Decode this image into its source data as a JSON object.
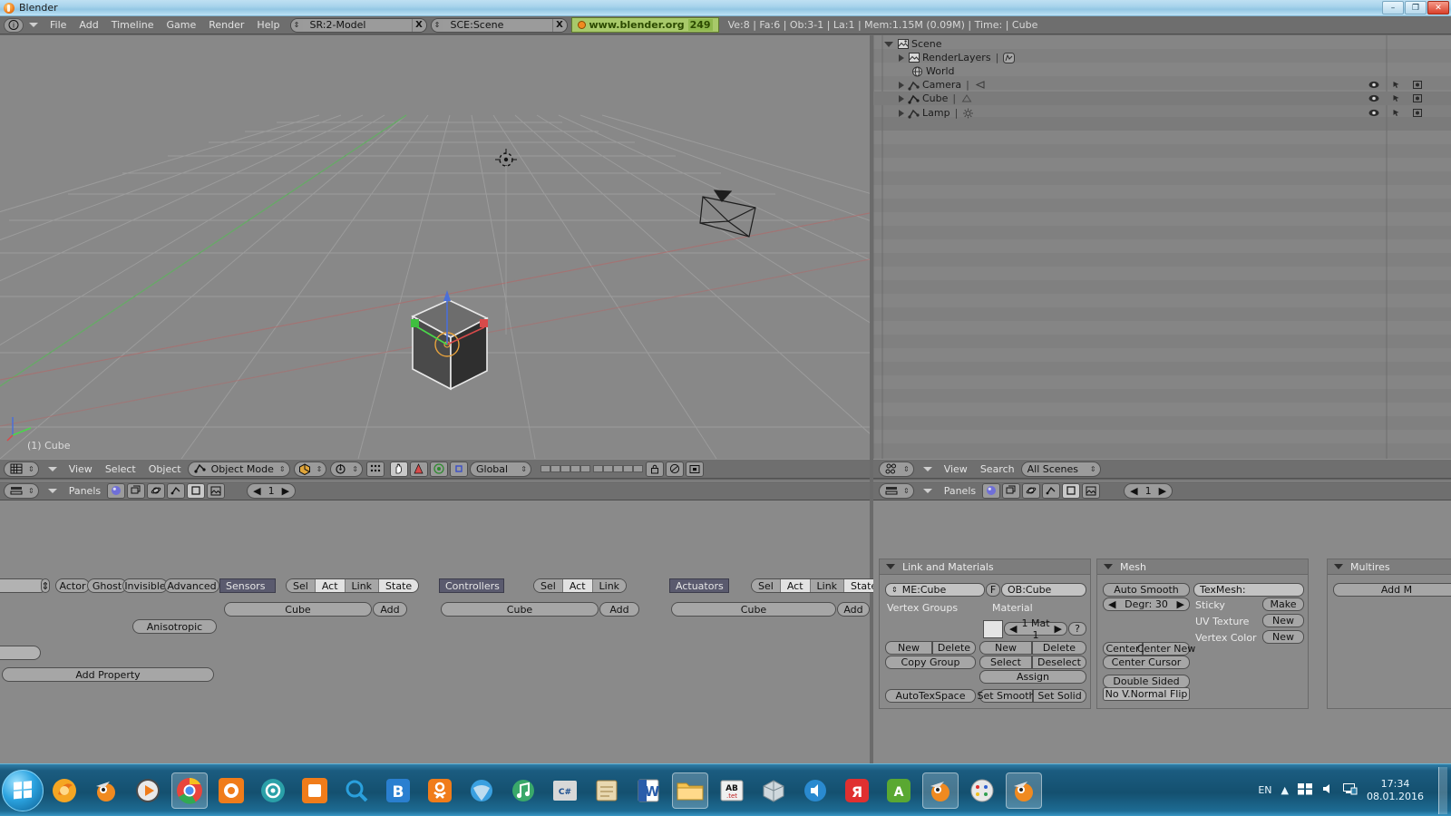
{
  "window": {
    "title": "Blender",
    "app_icon": "blender-icon",
    "minimize": "–",
    "maximize": "❐",
    "close": "✕"
  },
  "info_header": {
    "icon_button": "info-icon",
    "menus": [
      "File",
      "Add",
      "Timeline",
      "Game",
      "Render",
      "Help"
    ],
    "screen_field": {
      "value": "SR:2-Model",
      "close": "X"
    },
    "scene_field": {
      "value": "SCE:Scene",
      "close": "X"
    },
    "version_link": {
      "url": "www.blender.org",
      "version": "249"
    },
    "stats": "Ve:8 | Fa:6 | Ob:3-1 | La:1  | Mem:1.15M (0.09M)  | Time: | Cube"
  },
  "viewport": {
    "object_label": "(1) Cube",
    "header": {
      "editor_icon": "3d-view-icon",
      "menus": [
        "View",
        "Select",
        "Object"
      ],
      "mode": "Object Mode",
      "mode_icon": "object-mode-icon",
      "draw_type_icon": "solid-shading-icon",
      "rotate_icon": "pivot-icon",
      "pivot_icon": "pivot-median-icon",
      "manipulator_icons": [
        "hand-icon",
        "rotate-manip-icon",
        "scale-manip-icon",
        "transform-widget-icon"
      ],
      "orientation": "Global",
      "layers_label": "layer-grid",
      "lock_icon": "lock-icon",
      "render_icon": "render-preview-icon",
      "camera_icon": "camera-view-icon"
    }
  },
  "buttons_window_left": {
    "header": {
      "editor_icon": "logic-buttons-icon",
      "panels_label": "Panels",
      "context_icons": [
        "shading-icon",
        "object-icon",
        "physics-icon",
        "object-constraint-icon",
        "editing-icon",
        "scene-icon"
      ],
      "page": "1"
    },
    "physics": {
      "type_dropdown": "",
      "buttons": [
        "Actor",
        "Ghost",
        "Invisible",
        "Advanced"
      ],
      "anisotropic": "Anisotropic",
      "add_property": "Add Property",
      "empty_field": ""
    },
    "sensors": {
      "title": "Sensors",
      "filters": [
        "Sel",
        "Act",
        "Link",
        "State"
      ],
      "active_filter": "Act",
      "object": "Cube",
      "add": "Add"
    },
    "controllers": {
      "title": "Controllers",
      "filters": [
        "Sel",
        "Act",
        "Link"
      ],
      "active_filter": "Act",
      "object": "Cube",
      "add": "Add"
    },
    "actuators": {
      "title": "Actuators",
      "filters": [
        "Sel",
        "Act",
        "Link",
        "State"
      ],
      "active_filter": "Act",
      "object": "Cube",
      "add": "Add"
    }
  },
  "outliner": {
    "header": {
      "editor_icon": "outliner-icon",
      "menus": [
        "View",
        "Search"
      ],
      "display_mode": "All Scenes"
    },
    "tree": [
      {
        "indent": 0,
        "label": "Scene",
        "icon": "scene-icon",
        "expander": "open",
        "extra": ""
      },
      {
        "indent": 1,
        "label": "RenderLayers",
        "icon": "renderlayer-icon",
        "expander": "closed",
        "extra": "renderlayer-badge-icon"
      },
      {
        "indent": 1,
        "label": "World",
        "icon": "world-icon",
        "expander": "none",
        "extra": ""
      },
      {
        "indent": 1,
        "label": "Camera",
        "icon": "object-icon",
        "expander": "closed",
        "extra": "camera-data-icon"
      },
      {
        "indent": 1,
        "label": "Cube",
        "icon": "object-icon",
        "expander": "closed",
        "extra": "mesh-data-icon"
      },
      {
        "indent": 1,
        "label": "Lamp",
        "icon": "object-icon",
        "expander": "closed",
        "extra": "lamp-data-icon"
      }
    ],
    "restrict_icons": [
      "restrict-view-icon",
      "restrict-select-icon",
      "restrict-render-icon"
    ]
  },
  "buttons_window_right": {
    "header": {
      "editor_icon": "editing-buttons-icon",
      "panels_label": "Panels",
      "context_icons": [
        "shading-icon",
        "object-icon",
        "physics-icon",
        "object-constraint-icon",
        "editing-icon",
        "scene-icon"
      ],
      "page": "1"
    },
    "link_and_materials": {
      "title": "Link and Materials",
      "mesh_field": "ME:Cube",
      "f_button": "F",
      "object_field": "OB:Cube",
      "vertex_groups_label": "Vertex Groups",
      "material_label": "Material",
      "material_index": "1 Mat 1",
      "material_help": "?",
      "vg_new": "New",
      "vg_delete": "Delete",
      "vg_copy_group": "Copy Group",
      "mat_new": "New",
      "mat_delete": "Delete",
      "mat_select": "Select",
      "mat_deselect": "Deselect",
      "mat_assign": "Assign",
      "auto_tex_space": "AutoTexSpace",
      "set_smooth": "Set Smooth",
      "set_solid": "Set Solid"
    },
    "mesh": {
      "title": "Mesh",
      "auto_smooth": "Auto Smooth",
      "degr": "Degr: 30",
      "texmesh_label": "TexMesh:",
      "sticky_label": "Sticky",
      "sticky_button": "Make",
      "uv_texture_label": "UV Texture",
      "uv_texture_button": "New",
      "vertex_color_label": "Vertex Color",
      "vertex_color_button": "New",
      "center": "Center",
      "center_new": "Center New",
      "center_cursor": "Center Cursor",
      "double_sided": "Double Sided",
      "no_v_normal_flip": "No V.Normal Flip"
    },
    "multires": {
      "title": "Multires",
      "add_multires": "Add M"
    }
  },
  "taskbar": {
    "start_icon": "windows-start-icon",
    "items": [
      {
        "icon": "firefox-icon",
        "active": false
      },
      {
        "icon": "blender-icon",
        "active": false
      },
      {
        "icon": "media-player-icon",
        "active": false
      },
      {
        "icon": "chrome-icon",
        "active": true
      },
      {
        "icon": "orange-app-icon",
        "active": false
      },
      {
        "icon": "teal-app-icon",
        "active": false
      },
      {
        "icon": "orange-app2-icon",
        "active": false
      },
      {
        "icon": "search-icon",
        "active": false
      },
      {
        "icon": "letter-b-icon",
        "active": false
      },
      {
        "icon": "odnoklassniki-icon",
        "active": false
      },
      {
        "icon": "browser-icon",
        "active": false
      },
      {
        "icon": "music-icon",
        "active": false
      },
      {
        "icon": "sharpdevelop-icon",
        "active": false
      },
      {
        "icon": "notes-icon",
        "active": false
      },
      {
        "icon": "word-icon",
        "active": false
      },
      {
        "icon": "explorer-icon",
        "active": true
      },
      {
        "icon": "abbyy-icon",
        "active": false
      },
      {
        "icon": "box-icon",
        "active": false
      },
      {
        "icon": "speech-icon",
        "active": false
      },
      {
        "icon": "yandex-icon",
        "active": false
      },
      {
        "icon": "appstore-icon",
        "active": false
      },
      {
        "icon": "blender-icon-2",
        "active": true
      },
      {
        "icon": "paint-icon",
        "active": false
      },
      {
        "icon": "blender-icon-3",
        "active": true
      }
    ],
    "tray": {
      "language": "EN",
      "show_hidden": "show-hidden-icon",
      "network": "network-icon",
      "volume": "volume-icon",
      "action_center": "action-center-icon",
      "time": "17:34",
      "date": "08.01.2016"
    }
  },
  "colors": {
    "viewport_bg": "#888888",
    "panel_bg": "#8a8a8a",
    "header_bg": "#6f6f6f",
    "button_bg": "#a6a6a6",
    "title_bg": "#5a5a6e",
    "accent_green": "#a8c96a",
    "selected_outline": "#e8a33d",
    "axis_x": "#b66a6a",
    "axis_y": "#6aa86a"
  }
}
